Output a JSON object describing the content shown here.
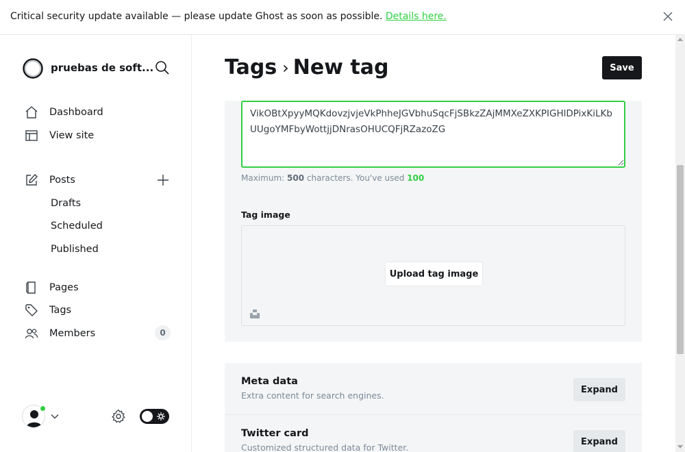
{
  "banner": {
    "message": "Critical security update available — please update Ghost as soon as possible.",
    "link_text": "Details here.",
    "close_icon": "close-icon"
  },
  "sidebar": {
    "site_title": "pruebas de soft...",
    "nav": [
      {
        "label": "Dashboard",
        "icon": "home-icon"
      },
      {
        "label": "View site",
        "icon": "browser-icon"
      },
      {
        "label": "Posts",
        "icon": "edit-icon"
      },
      {
        "label": "Pages",
        "icon": "page-icon"
      },
      {
        "label": "Tags",
        "icon": "tag-icon"
      },
      {
        "label": "Members",
        "icon": "members-icon"
      }
    ],
    "posts_sub": [
      "Drafts",
      "Scheduled",
      "Published"
    ],
    "members_count": "0"
  },
  "header": {
    "crumb_parent": "Tags",
    "crumb_separator": "›",
    "crumb_current": "New tag",
    "save_label": "Save"
  },
  "form": {
    "description_value": "VikOBtXpyyMQKdovzjvjeVkPhheJGVbhuSqcFjSBkzZAjMMXeZXKPIGHlDPixKiLKbUUgoYMFbyWottjjDNrasOHUCQFjRZazoZG",
    "hint_prefix": "Maximum:",
    "hint_max": "500",
    "hint_middle": "characters. You've used",
    "hint_used": "100",
    "image_label": "Tag image",
    "upload_label": "Upload tag image"
  },
  "sections": [
    {
      "title": "Meta data",
      "subtitle": "Extra content for search engines.",
      "button": "Expand"
    },
    {
      "title": "Twitter card",
      "subtitle": "Customized structured data for Twitter.",
      "button": "Expand"
    }
  ],
  "colors": {
    "accent": "#30cf43",
    "dark": "#15171a",
    "panel": "#f4f5f6"
  }
}
